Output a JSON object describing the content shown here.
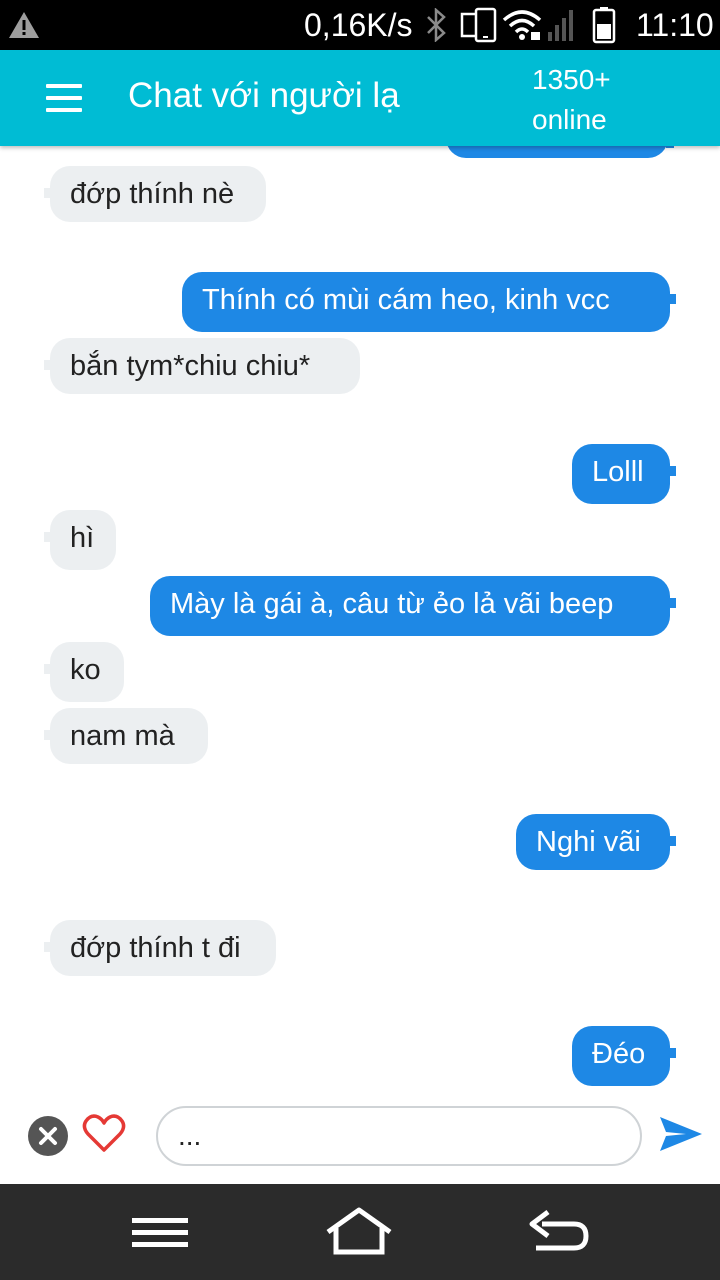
{
  "status_bar": {
    "net_speed": "0,16K/s",
    "time": "11:10",
    "icons": [
      "warning-icon",
      "bluetooth-icon",
      "phone-sync-icon",
      "wifi-icon",
      "signal-icon",
      "battery-icon"
    ]
  },
  "app_bar": {
    "title": "Chat với người lạ",
    "online_count": "1350+",
    "online_label": "online",
    "color": "#00bcd4"
  },
  "messages": [
    {
      "from": "stranger",
      "text": "đớp thính nè"
    },
    {
      "from": "me",
      "text": "Thính có mùi cám heo, kinh vcc"
    },
    {
      "from": "stranger",
      "text": "bắn tym*chiu chiu*"
    },
    {
      "from": "me",
      "text": "Lolll"
    },
    {
      "from": "stranger",
      "text": "hì"
    },
    {
      "from": "me",
      "text": "Mày là gái à, câu từ ẻo lả vãi beep"
    },
    {
      "from": "stranger",
      "text": "ko"
    },
    {
      "from": "stranger",
      "text": "nam mà"
    },
    {
      "from": "me",
      "text": "Nghi vãi"
    },
    {
      "from": "stranger",
      "text": "đớp thính t đi"
    },
    {
      "from": "me",
      "text": "Đéo"
    }
  ],
  "composer": {
    "input_value": "...",
    "icons": [
      "close-icon",
      "heart-icon",
      "send-icon"
    ]
  },
  "colors": {
    "incoming_bubble": "#eceff1",
    "outgoing_bubble": "#1e88e5",
    "nav_bar": "#2b2b2b"
  }
}
